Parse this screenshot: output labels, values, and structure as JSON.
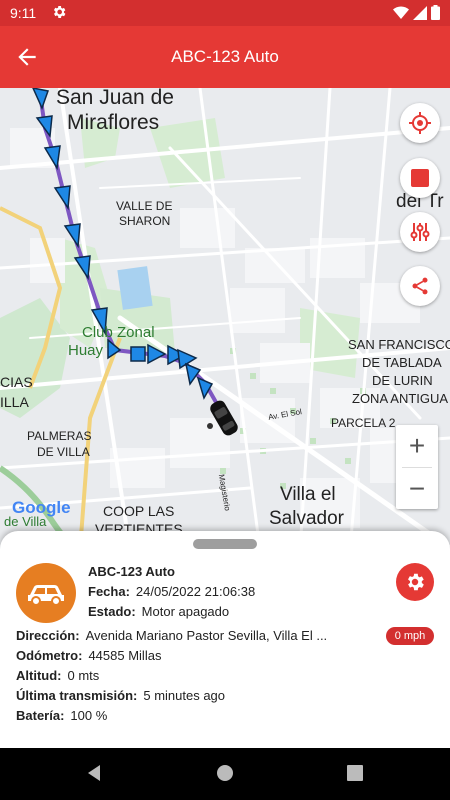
{
  "status_bar": {
    "time": "9:11"
  },
  "app_bar": {
    "title": "ABC-123 Auto"
  },
  "map": {
    "labels": {
      "san_juan": "San Juan de",
      "miraflores": "Miraflores",
      "valle_sharon_1": "VALLE DE",
      "valle_sharon_2": "SHARON",
      "club_zonal": "Club Zonal",
      "huay": "Huay",
      "cias": "CIAS",
      "illa": "ILLA",
      "palmeras_1": "PALMERAS",
      "palmeras_2": "DE VILLA",
      "san_francisco_1": "SAN FRANCISCO",
      "san_francisco_2": "DE TABLADA",
      "san_francisco_3": "DE LURIN",
      "zona_antigua": "ZONA ANTIGUA",
      "parcela": "PARCELA 2",
      "av_el_sol": "Av. El Sol",
      "coop_1": "COOP LAS",
      "coop_2": "VERTIENTES",
      "villa_salvador_1": "Villa el",
      "villa_salvador_2": "Salvador",
      "de_villa": "de Villa",
      "del_tr": "del Tr",
      "google": "Google",
      "magisterio": "Magisterio"
    },
    "zoom_in": "+",
    "zoom_out": "−"
  },
  "sheet": {
    "vehicle_name": "ABC-123 Auto",
    "fecha_label": "Fecha:",
    "fecha_value": "24/05/2022 21:06:38",
    "estado_label": "Estado:",
    "estado_value": "Motor apagado",
    "direccion_label": "Dirección:",
    "direccion_value": "Avenida Mariano Pastor Sevilla, Villa El ...",
    "odometro_label": "Odómetro:",
    "odometro_value": "44585 Millas",
    "altitud_label": "Altitud:",
    "altitud_value": "0 mts",
    "ultima_label": "Última transmisión:",
    "ultima_value": "5 minutes ago",
    "bateria_label": "Batería:",
    "bateria_value": "100 %",
    "speed": "0 mph"
  },
  "colors": {
    "accent": "#e53935",
    "avatar": "#e67e22",
    "route_arrow": "#1e88e5",
    "route_line": "#7e57c2"
  }
}
